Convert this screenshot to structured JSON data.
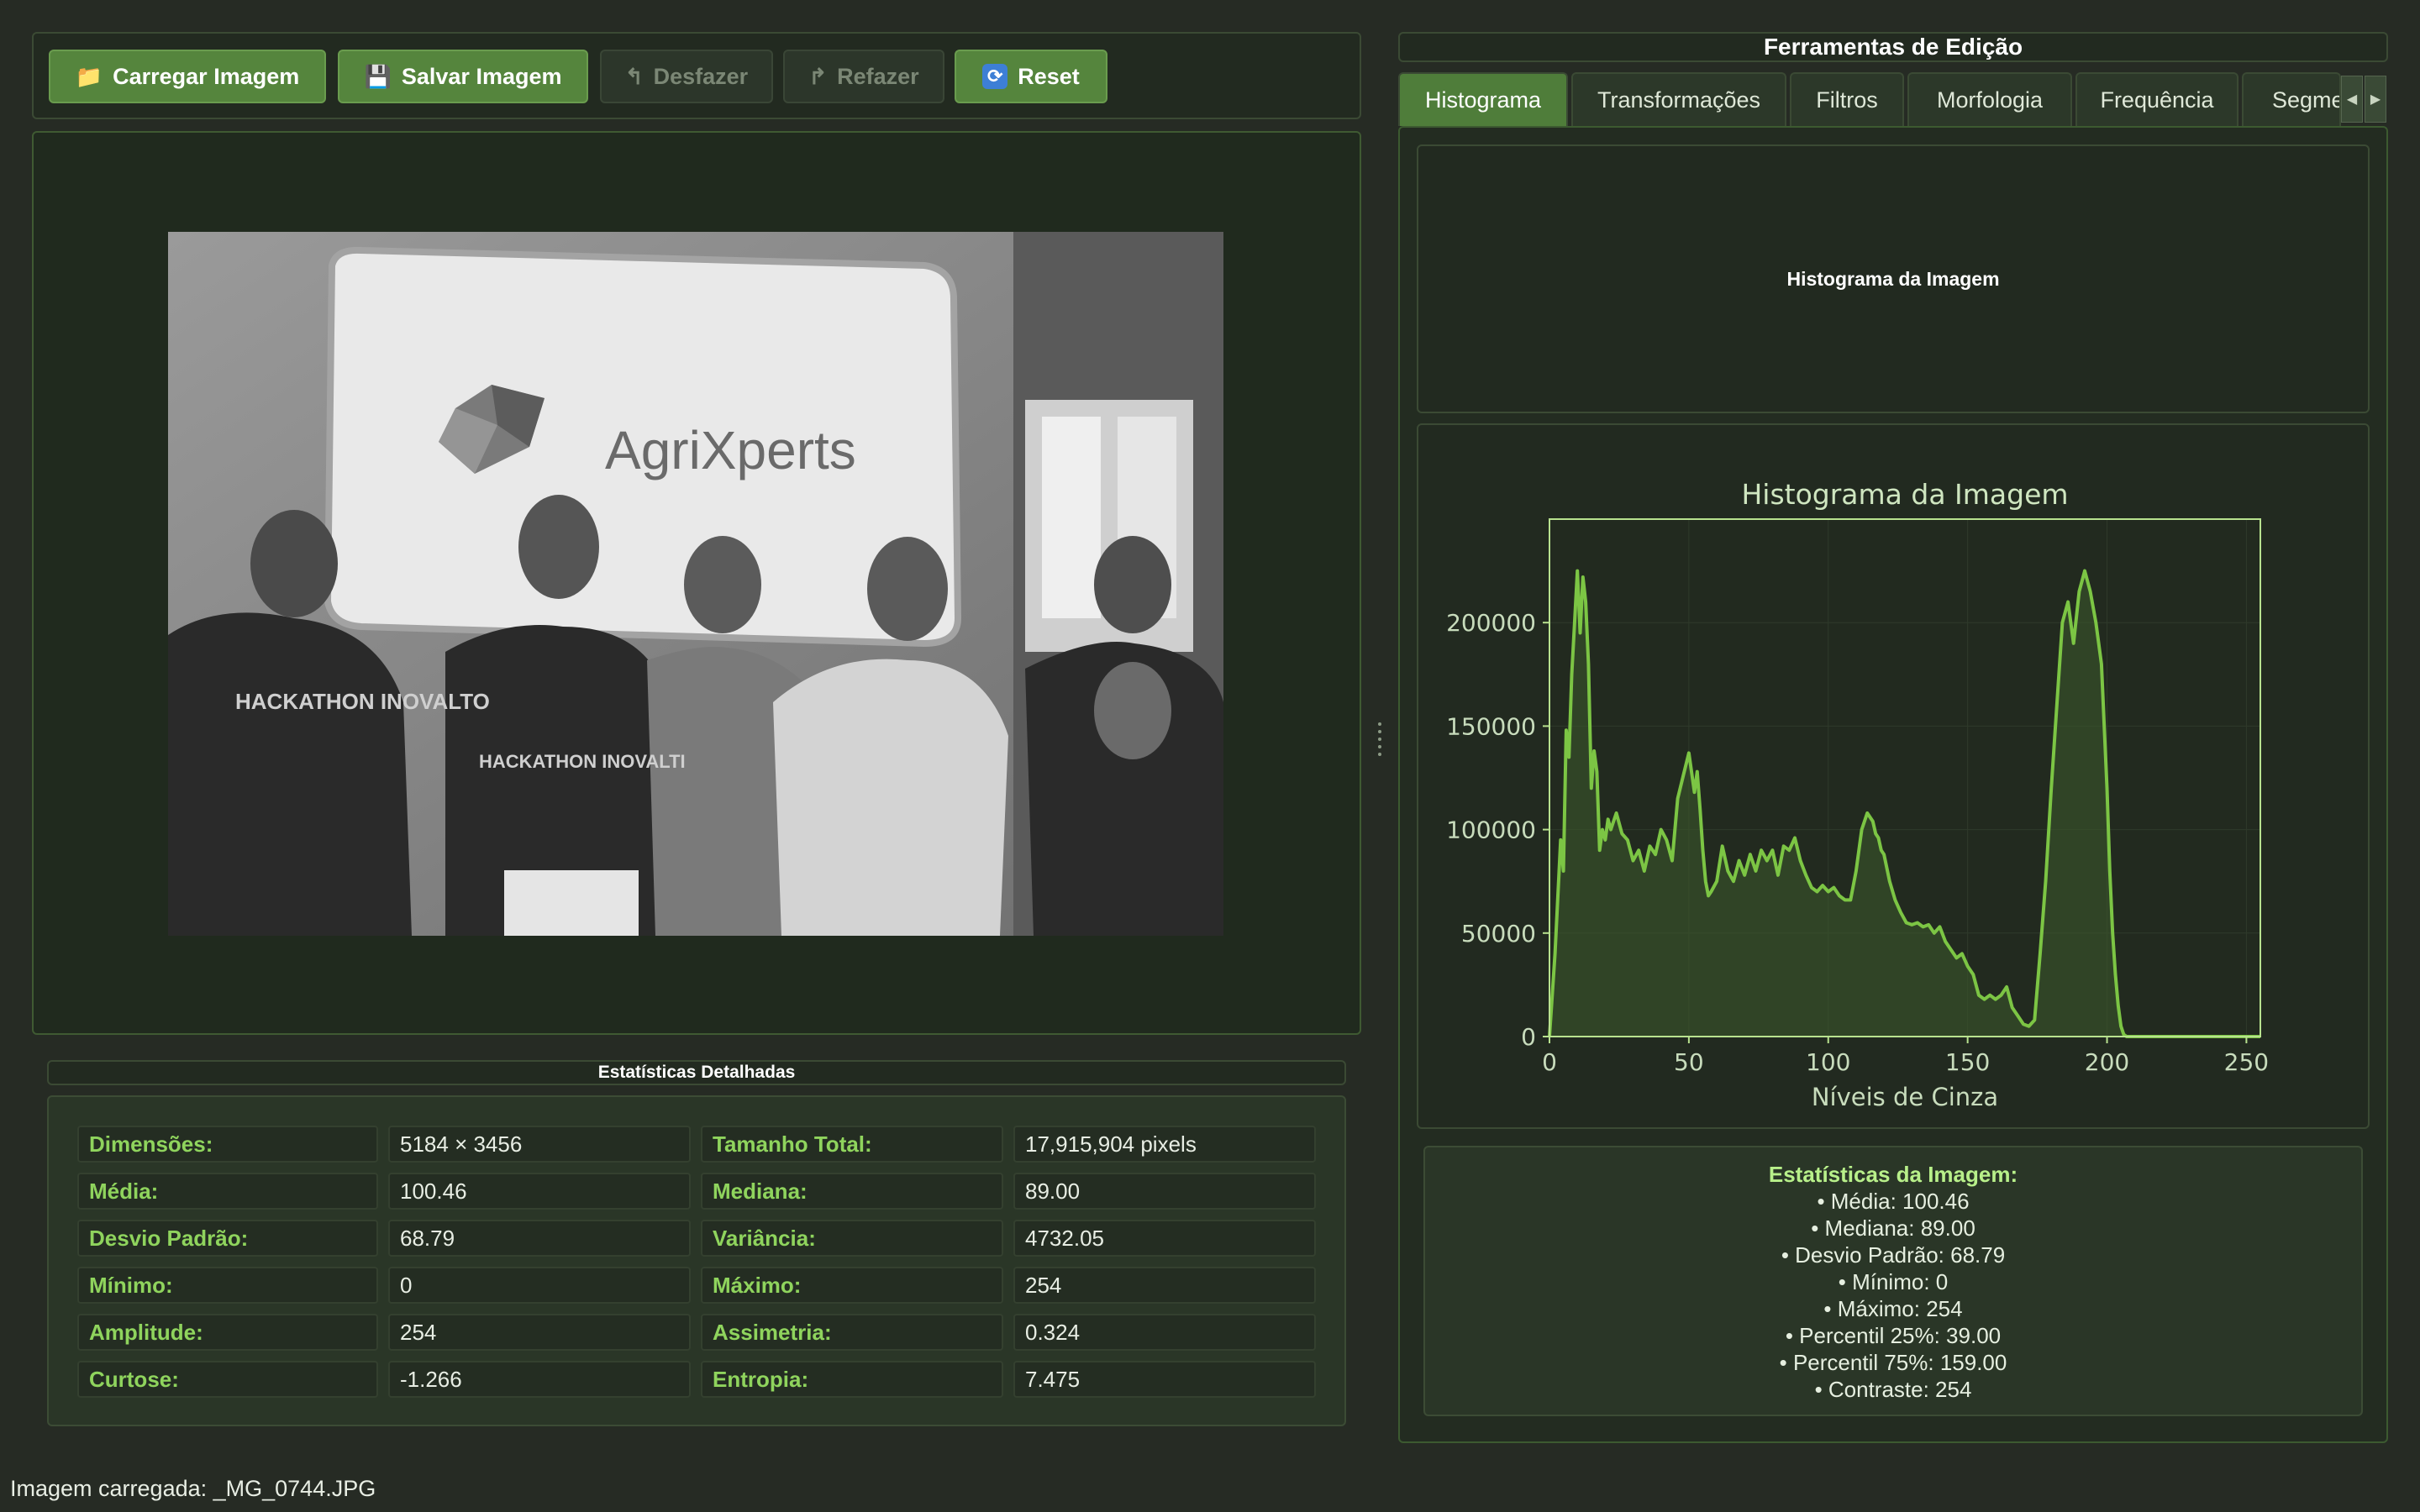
{
  "toolbar": {
    "load_label": "Carregar Imagem",
    "load_icon": "folder-icon",
    "save_label": "Salvar Imagem",
    "save_icon": "floppy-disk-icon",
    "undo_label": "Desfazer",
    "undo_icon": "undo-arrow-icon",
    "redo_label": "Refazer",
    "redo_icon": "redo-arrow-icon",
    "reset_label": "Reset",
    "reset_icon": "refresh-icon"
  },
  "image": {
    "logo_text": "AgriXperts",
    "shirt_text_1": "HACKATHON INOVALTO",
    "shirt_text_2": "HACKATHON INOVALTI"
  },
  "stats_table": {
    "title": "Estatísticas Detalhadas",
    "rows": [
      {
        "l1": "Dimensões:",
        "v1": "5184 × 3456",
        "l2": "Tamanho Total:",
        "v2": "17,915,904 pixels"
      },
      {
        "l1": "Média:",
        "v1": "100.46",
        "l2": "Mediana:",
        "v2": "89.00"
      },
      {
        "l1": "Desvio Padrão:",
        "v1": "68.79",
        "l2": "Variância:",
        "v2": "4732.05"
      },
      {
        "l1": "Mínimo:",
        "v1": "0",
        "l2": "Máximo:",
        "v2": "254"
      },
      {
        "l1": "Amplitude:",
        "v1": "254",
        "l2": "Assimetria:",
        "v2": "0.324"
      },
      {
        "l1": "Curtose:",
        "v1": "-1.266",
        "l2": "Entropia:",
        "v2": "7.475"
      }
    ]
  },
  "right_panel": {
    "title": "Ferramentas de Edição",
    "tabs": [
      "Histograma",
      "Transformações",
      "Filtros",
      "Morfologia",
      "Frequência",
      "Segme"
    ],
    "active_tab": "Histograma",
    "chart_header": "Histograma da Imagem"
  },
  "chart_data": {
    "type": "area",
    "title": "Histograma da Imagem",
    "xlabel": "Níveis de Cinza",
    "ylabel": "",
    "xlim": [
      0,
      255
    ],
    "ylim": [
      0,
      250000
    ],
    "xticks": [
      0,
      50,
      100,
      150,
      200,
      250
    ],
    "yticks": [
      0,
      50000,
      100000,
      150000,
      200000
    ],
    "line_color": "#7cc544",
    "fill_color": "#3d5a2c",
    "series": [
      {
        "x": [
          0,
          2,
          4,
          5,
          6,
          7,
          8,
          9,
          10,
          11,
          12,
          13,
          14,
          15,
          16,
          17,
          18,
          19,
          20,
          21,
          22,
          24,
          26,
          28,
          30,
          32,
          34,
          36,
          38,
          40,
          42,
          44,
          46,
          48,
          50,
          52,
          53,
          54,
          55,
          56,
          57,
          58,
          60,
          62,
          64,
          66,
          68,
          70,
          72,
          74,
          76,
          78,
          80,
          82,
          84,
          86,
          88,
          90,
          92,
          94,
          96,
          98,
          100,
          102,
          104,
          106,
          108,
          110,
          112,
          114,
          116,
          117,
          118,
          119,
          120,
          122,
          124,
          126,
          128,
          130,
          132,
          134,
          136,
          138,
          140,
          142,
          144,
          146,
          148,
          150,
          152,
          154,
          156,
          158,
          160,
          162,
          164,
          166,
          168,
          170,
          172,
          174,
          176,
          178,
          180,
          182,
          184,
          186,
          188,
          190,
          192,
          194,
          196,
          198,
          199,
          200,
          201,
          202,
          203,
          204,
          205,
          206,
          207,
          208,
          209,
          210,
          211,
          212,
          213,
          214,
          215,
          216,
          218,
          220,
          230,
          240,
          255
        ],
        "values": [
          0,
          40000,
          95000,
          80000,
          148000,
          135000,
          175000,
          200000,
          225000,
          195000,
          222000,
          210000,
          180000,
          120000,
          138000,
          128000,
          90000,
          100000,
          95000,
          105000,
          100000,
          108000,
          98000,
          95000,
          85000,
          90000,
          80000,
          92000,
          88000,
          100000,
          95000,
          85000,
          115000,
          126000,
          137000,
          118000,
          128000,
          110000,
          90000,
          75000,
          68000,
          70000,
          75000,
          92000,
          80000,
          75000,
          85000,
          78000,
          88000,
          80000,
          90000,
          85000,
          90000,
          78000,
          92000,
          90000,
          96000,
          85000,
          78000,
          72000,
          70000,
          73000,
          70000,
          72000,
          68000,
          66000,
          66000,
          80000,
          100000,
          108000,
          104000,
          98000,
          96000,
          90000,
          88000,
          75000,
          66000,
          60000,
          55000,
          54000,
          55000,
          53000,
          54000,
          50000,
          53000,
          46000,
          42000,
          38000,
          40000,
          34000,
          30000,
          20000,
          18000,
          20000,
          18000,
          20000,
          24000,
          14000,
          10000,
          6000,
          5000,
          8000,
          40000,
          75000,
          120000,
          160000,
          200000,
          210000,
          190000,
          215000,
          225000,
          215000,
          200000,
          180000,
          150000,
          120000,
          80000,
          50000,
          30000,
          15000,
          5000,
          1000,
          0,
          0,
          0,
          0,
          0,
          0,
          0,
          0,
          0,
          0,
          0,
          0,
          0,
          0,
          0
        ]
      }
    ]
  },
  "image_stats": {
    "title": "Estatísticas da Imagem:",
    "lines": [
      "• Média: 100.46",
      "• Mediana: 89.00",
      "• Desvio Padrão: 68.79",
      "• Mínimo: 0",
      "• Máximo: 254",
      "• Percentil 25%: 39.00",
      "• Percentil 75%: 159.00",
      "• Contraste: 254"
    ]
  },
  "status_bar": {
    "text": "Imagem carregada: _MG_0744.JPG"
  }
}
